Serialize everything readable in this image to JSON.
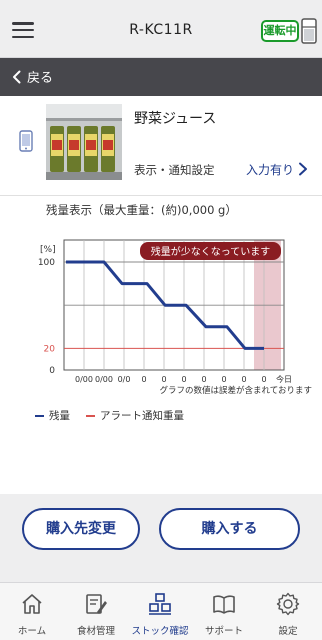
{
  "header": {
    "title": "R-KC11R",
    "status_badge": "運転中",
    "back_label": "戻る"
  },
  "product": {
    "name": "野菜ジュース",
    "notify_label": "表示・通知設定",
    "notify_status": "入力有り"
  },
  "capacity": {
    "label": "残量表示（最大重量：(約)0,000 g）"
  },
  "chart_data": {
    "type": "line",
    "y_unit_label": "[%]",
    "y_ticks": [
      "100",
      "20",
      "0"
    ],
    "ylim": [
      0,
      100
    ],
    "x_tick_labels": [
      "0/00",
      "0/00",
      "0/0",
      "0",
      "0",
      "0",
      "0",
      "0",
      "0",
      "0",
      "今日"
    ],
    "series": [
      {
        "name": "残量",
        "color": "#223d8e",
        "values": [
          100,
          100,
          80,
          80,
          60,
          60,
          40,
          40,
          20,
          20
        ]
      }
    ],
    "alert_threshold": {
      "name": "アラート通知重量",
      "value": 20,
      "color": "#d9534f"
    },
    "alert_banner": "残量が少なくなっています",
    "today_highlight_color": "#e3b5bd",
    "note": "グラフの数値は誤差が含まれております",
    "grid": true,
    "legend_position": "bottom-left"
  },
  "actions": {
    "change_supplier": "購入先変更",
    "buy": "購入する"
  },
  "tabs": [
    {
      "label": "ホーム",
      "icon": "home-icon",
      "active": false
    },
    {
      "label": "食材管理",
      "icon": "edit-icon",
      "active": false
    },
    {
      "label": "ストック確認",
      "icon": "stock-icon",
      "active": true
    },
    {
      "label": "サポート",
      "icon": "book-icon",
      "active": false
    },
    {
      "label": "設定",
      "icon": "gear-icon",
      "active": false
    }
  ],
  "colors": {
    "brand": "#223d8e",
    "running": "#1a9a2b",
    "alert": "#d9534f",
    "banner": "#8a1c22",
    "backbar": "#47474c"
  }
}
